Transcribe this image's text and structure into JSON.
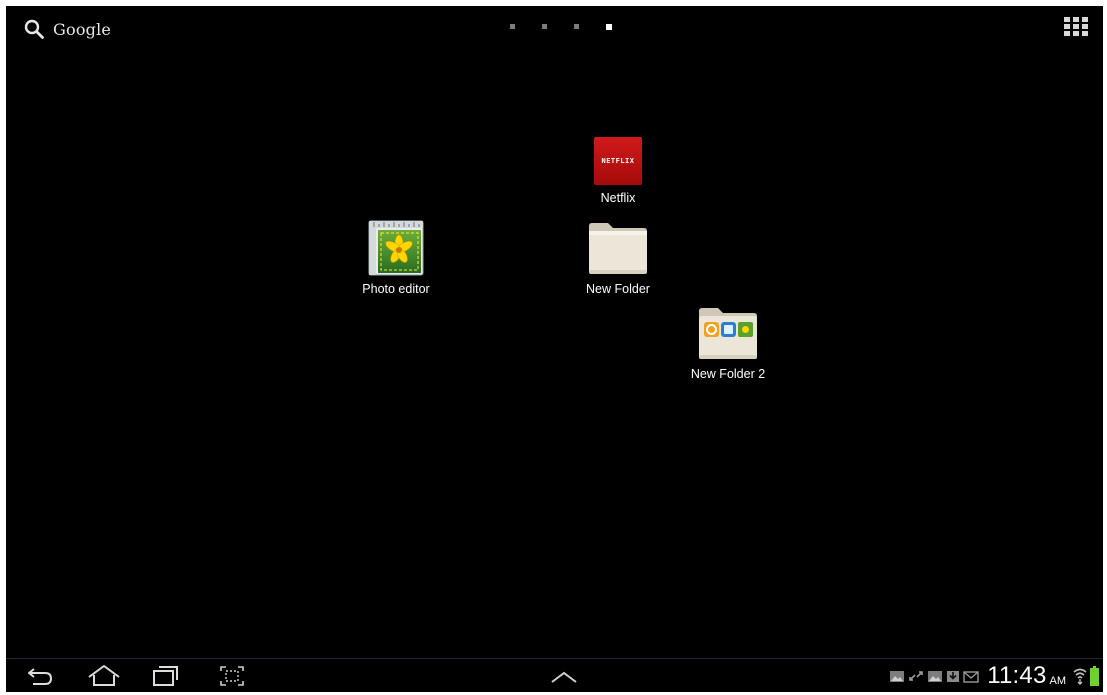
{
  "search": {
    "label": "Google",
    "icon": "search-icon"
  },
  "home_pages": {
    "count": 4,
    "active_index": 3
  },
  "apps_button": {
    "icon": "apps-grid-icon"
  },
  "shortcuts": [
    {
      "id": "netflix",
      "label": "Netflix",
      "icon": "netflix-icon",
      "wordmark": "NETFLIX"
    },
    {
      "id": "photo-editor",
      "label": "Photo editor",
      "icon": "photo-editor-icon"
    },
    {
      "id": "new-folder",
      "label": "New Folder",
      "icon": "folder-icon"
    },
    {
      "id": "new-folder-2",
      "label": "New Folder 2",
      "icon": "folder-with-apps-icon"
    }
  ],
  "navigation": {
    "back": "back-icon",
    "home": "home-icon",
    "recents": "recent-apps-icon",
    "screenshot": "screenshot-icon",
    "drawer": "chevron-up-icon"
  },
  "status_bar": {
    "notifications": [
      "gallery-icon",
      "sync-icon",
      "gallery-icon",
      "download-icon",
      "email-icon"
    ],
    "time": "11:43",
    "ampm": "AM",
    "wifi": "wifi-icon",
    "battery": "battery-icon"
  },
  "colors": {
    "background": "#000000",
    "netflix_red": "#c41515",
    "battery_green": "#6fd12e"
  }
}
